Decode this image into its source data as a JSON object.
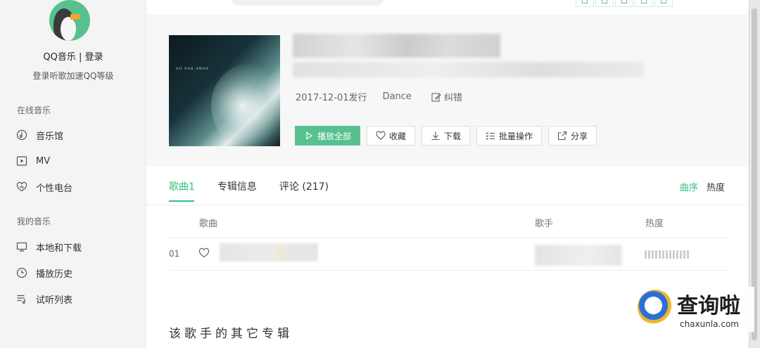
{
  "sidebar": {
    "qq_music": "QQ音乐",
    "divider": "|",
    "login": "登录",
    "login_prompt": "登录听歌加速QQ等级",
    "online_section": "在线音乐",
    "online_items": [
      {
        "label": "音乐馆",
        "icon": "music-hall-icon"
      },
      {
        "label": "MV",
        "icon": "mv-icon"
      },
      {
        "label": "个性电台",
        "icon": "radio-heart-icon"
      }
    ],
    "my_section": "我的音乐",
    "my_items": [
      {
        "label": "本地和下载",
        "icon": "monitor-icon"
      },
      {
        "label": "播放历史",
        "icon": "clock-icon"
      },
      {
        "label": "试听列表",
        "icon": "playlist-icon"
      }
    ]
  },
  "album": {
    "cover_text": "SO FAR AWAY",
    "release": "2017-12-01发行",
    "genre": "Dance",
    "correct": "纠错"
  },
  "actions": {
    "play_all": "播放全部",
    "favorite": "收藏",
    "download": "下载",
    "batch": "批量操作",
    "share": "分享"
  },
  "tabs": {
    "songs": "歌曲1",
    "album_info": "专辑信息",
    "comments": "评论 (217)"
  },
  "sort": {
    "by_order": "曲序",
    "by_heat": "热度"
  },
  "table": {
    "col_song": "歌曲",
    "col_singer": "歌手",
    "col_heat": "热度",
    "rows": [
      {
        "index": "01"
      }
    ]
  },
  "other_albums_title": "该歌手的其它专辑",
  "watermark": {
    "name": "查询啦",
    "site": "chaxunla.com"
  },
  "colors": {
    "accent": "#31c27c",
    "primary_button": "#57c08f"
  }
}
